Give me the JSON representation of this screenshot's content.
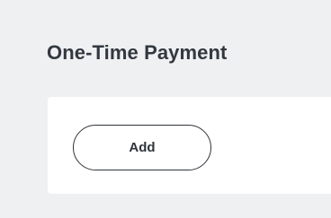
{
  "section": {
    "title": "One-Time Payment",
    "add_button_label": "Add"
  }
}
